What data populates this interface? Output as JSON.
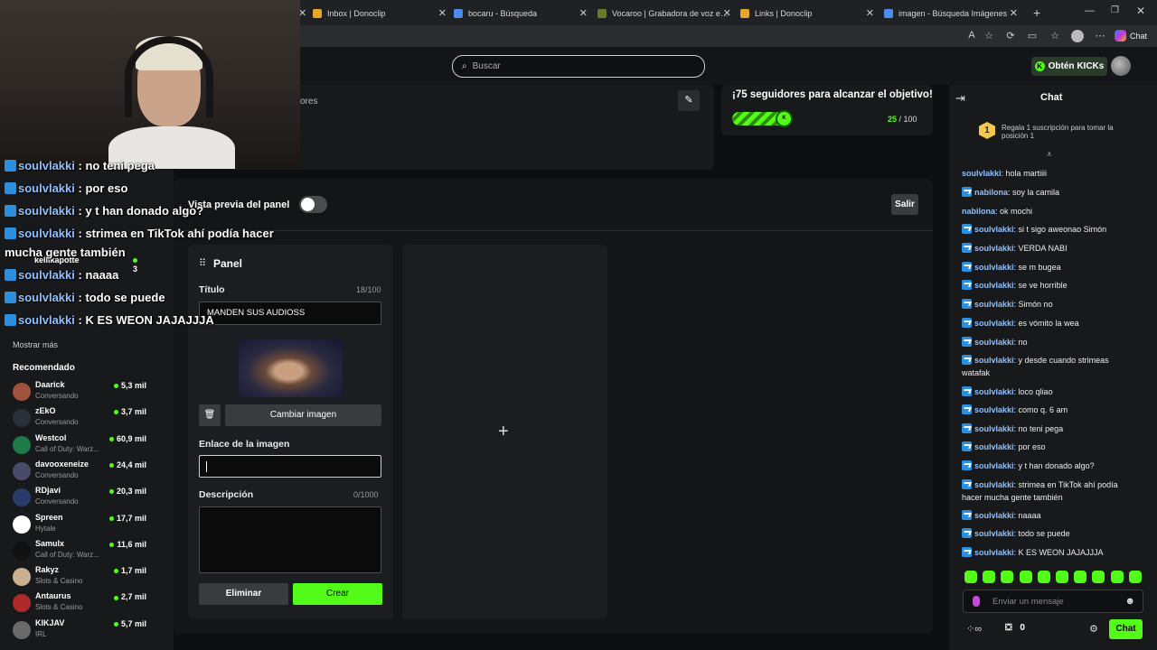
{
  "browser": {
    "tabs": [
      {
        "title": "Inbox | Donoclip",
        "color": "#e8a42c"
      },
      {
        "title": "bocaru - Búsqueda",
        "color": "#4a8cf0"
      },
      {
        "title": "Vocaroo | Grabadora de voz en lín",
        "color": "#6b7b2a"
      },
      {
        "title": "Links | Donoclip",
        "color": "#e8a42c"
      },
      {
        "title": "imagen - Búsqueda Imágenes",
        "color": "#4a8cf0"
      }
    ],
    "copilot_label": "Chat"
  },
  "header": {
    "search_placeholder": "Buscar",
    "kicks_label": "Obtén KICKs"
  },
  "stream_info": {
    "followers_fragment": "ores"
  },
  "goal": {
    "title": "¡75 seguidores para alcanzar el objetivo!",
    "current": "25",
    "separator": " / ",
    "target": "100",
    "progress_fraction": 0.25
  },
  "sidebar": {
    "show_more": "Mostrar más",
    "recommended_title": "Recomendado",
    "recommended": [
      {
        "name": "Daarick",
        "category": "Conversando",
        "viewers": "5,3 mil",
        "color": "#a0523a"
      },
      {
        "name": "zEkO",
        "category": "Conversando",
        "viewers": "3,7 mil",
        "color": "#2a2f3a"
      },
      {
        "name": "Westcol",
        "category": "Call of Duty: Warz...",
        "viewers": "60,9 mil",
        "color": "#1f7a4a"
      },
      {
        "name": "davooxeneize",
        "category": "Conversando",
        "viewers": "24,4 mil",
        "color": "#4a4a6a"
      },
      {
        "name": "RDjavi",
        "category": "Conversando",
        "viewers": "20,3 mil",
        "color": "#2a3a6a"
      },
      {
        "name": "Spreen",
        "category": "Hytale",
        "viewers": "17,7 mil",
        "color": "#ffffff"
      },
      {
        "name": "Samulx",
        "category": "Call of Duty: Warz...",
        "viewers": "11,6 mil",
        "color": "#111111"
      },
      {
        "name": "Rakyz",
        "category": "Slots & Casino",
        "viewers": "1,7 mil",
        "color": "#c9b090"
      },
      {
        "name": "Antaurus",
        "category": "Slots & Casino",
        "viewers": "2,7 mil",
        "color": "#b02a2a"
      },
      {
        "name": "KIKJAV",
        "category": "IRL",
        "viewers": "5,7 mil",
        "color": "#6a6a6a"
      }
    ],
    "hidden_entries": [
      {
        "name": "kellikapotte",
        "viewers": "3"
      }
    ]
  },
  "panel_editor": {
    "preview_label": "Vista previa del panel",
    "exit_label": "Salir",
    "panel_title": "Panel",
    "title_label": "Título",
    "title_count": "18/100",
    "title_value": "MANDEN SUS AUDIOSS",
    "change_image": "Cambiar imagen",
    "image_link_label": "Enlace de la imagen",
    "image_link_value": "",
    "description_label": "Descripción",
    "description_count": "0/1000",
    "description_value": "",
    "delete_label": "Eliminar",
    "create_label": "Crear",
    "add_symbol": "+"
  },
  "chat": {
    "title": "Chat",
    "gift_rank": "1",
    "gift_text": "Regala 1 suscripción para tomar la posición 1",
    "messages": [
      {
        "user": "soulvlakki",
        "text": "hola martiiii",
        "badge": false
      },
      {
        "user": "nabilona",
        "text": "soy la camila",
        "badge": true
      },
      {
        "user": "nabilona",
        "text": "ok mochi",
        "badge": false
      },
      {
        "user": "soulvlakki",
        "text": "si t sigo aweonao Simón",
        "badge": true
      },
      {
        "user": "soulvlakki",
        "text": "VERDA NABI",
        "badge": true
      },
      {
        "user": "soulvlakki",
        "text": "se m bugea",
        "badge": true
      },
      {
        "user": "soulvlakki",
        "text": "se ve horrible",
        "badge": true
      },
      {
        "user": "soulvlakki",
        "text": "Simón no",
        "badge": true
      },
      {
        "user": "soulvlakki",
        "text": "es vómito la wea",
        "badge": true
      },
      {
        "user": "soulvlakki",
        "text": "no",
        "badge": true
      },
      {
        "user": "soulvlakki",
        "text": "y desde cuando strimeas watafak",
        "badge": true
      },
      {
        "user": "soulvlakki",
        "text": "loco qliao",
        "badge": true
      },
      {
        "user": "soulvlakki",
        "text": "como q. 6 am",
        "badge": true
      },
      {
        "user": "soulvlakki",
        "text": "no teni pega",
        "badge": true
      },
      {
        "user": "soulvlakki",
        "text": "por eso",
        "badge": true
      },
      {
        "user": "soulvlakki",
        "text": "y t han donado algo?",
        "badge": true
      },
      {
        "user": "soulvlakki",
        "text": "strimea en TikTok ahí podía hacer mucha gente también",
        "badge": true
      },
      {
        "user": "soulvlakki",
        "text": "naaaa",
        "badge": true
      },
      {
        "user": "soulvlakki",
        "text": "todo se puede",
        "badge": true
      },
      {
        "user": "soulvlakki",
        "text": "K ES WEON JAJAJJJA",
        "badge": true
      }
    ],
    "input_placeholder": "Enviar un mensaje",
    "kicks_count": "0",
    "send_label": "Chat"
  },
  "overlay": {
    "lines": [
      {
        "user": "soulvlakki",
        "text": ": no teni pega"
      },
      {
        "user": "soulvlakki",
        "text": ": por eso"
      },
      {
        "user": "soulvlakki",
        "text": ": y t han donado algo?"
      },
      {
        "user": "soulvlakki",
        "text": ": strimea en TikTok ahí podía hacer"
      },
      {
        "user": "",
        "text": "mucha gente también"
      },
      {
        "user": "soulvlakki",
        "text": ": naaaa"
      },
      {
        "user": "soulvlakki",
        "text": ": todo se puede"
      },
      {
        "user": "soulvlakki",
        "text": ": K ES WEON JAJAJJJA"
      }
    ]
  },
  "colors": {
    "accent": "#53fc18",
    "username": "#8fc0ff"
  }
}
